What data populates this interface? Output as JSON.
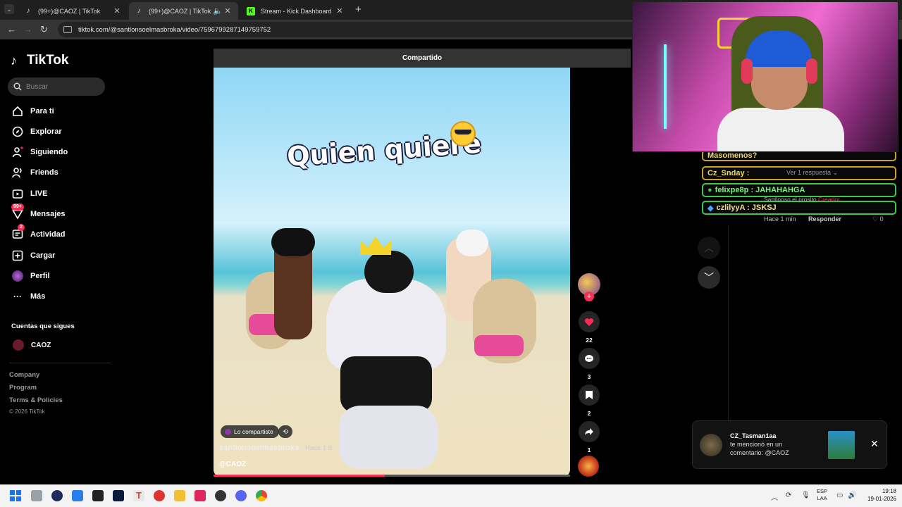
{
  "browser": {
    "tabs": [
      {
        "label": "(99+)@CAOZ | TikTok",
        "icon": "tiktok-icon"
      },
      {
        "label": "(99+)@CAOZ | TikTok",
        "icon": "tiktok-icon",
        "active": true
      },
      {
        "label": "Stream - Kick Dashboard",
        "icon": "kick-icon"
      }
    ],
    "url": "tiktok.com/@santlonsoelmasbroka/video/7596799287149759752"
  },
  "sidebar": {
    "logo": "TikTok",
    "search_placeholder": "Buscar",
    "items": [
      {
        "label": "Para ti",
        "icon": "home-icon"
      },
      {
        "label": "Explorar",
        "icon": "compass-icon"
      },
      {
        "label": "Siguiendo",
        "icon": "following-icon"
      },
      {
        "label": "Friends",
        "icon": "friends-icon"
      },
      {
        "label": "LIVE",
        "icon": "live-icon"
      },
      {
        "label": "Mensajes",
        "icon": "messages-icon",
        "badge": "99+"
      },
      {
        "label": "Actividad",
        "icon": "activity-icon",
        "badge": "2"
      },
      {
        "label": "Cargar",
        "icon": "upload-icon"
      },
      {
        "label": "Perfil",
        "icon": "profile-icon"
      },
      {
        "label": "Más",
        "icon": "more-icon"
      }
    ],
    "following_title": "Cuentas que sigues",
    "following": [
      {
        "name": "CAOZ"
      }
    ],
    "footer": [
      "Company",
      "Program",
      "Terms & Policies"
    ],
    "copyright": "© 2026 TikTok"
  },
  "video": {
    "shared_label": "Compartido",
    "caption": "Quien quiere",
    "shared_chip": "Lo compartiste",
    "author": "santlonsoelmasbroka",
    "posted": "· Hace 1 d",
    "mention": "@CAOZ",
    "progress": 0.48
  },
  "actions": {
    "likes": "22",
    "comments": "3",
    "saves": "2",
    "shares": "1"
  },
  "comments": {
    "reply_link": "Ver 1 respuesta",
    "reply_author": "Santlonso el prosito",
    "reply_author_tag": "Creador",
    "meta_time": "Hace 1 min",
    "reply_button": "Responder",
    "like_count": "0"
  },
  "stream_chat": [
    {
      "text": "Masomenos?",
      "color": "#c9a227"
    },
    {
      "text": "Cz_Snday :",
      "color": "#c9a227"
    },
    {
      "text": "felixpe8p : JAHAHAHGA",
      "color": "#3ec74a"
    },
    {
      "text": "czlilyyA : JSKSJ",
      "color": "#3ec74a"
    }
  ],
  "notification": {
    "name": "CZ_Tasman1aa",
    "text": "te mencionó en un comentario: @CAOZ"
  },
  "taskbar": {
    "lang_top": "ESP",
    "lang_bottom": "LAA",
    "time": "19:18",
    "date": "19-01-2026"
  }
}
